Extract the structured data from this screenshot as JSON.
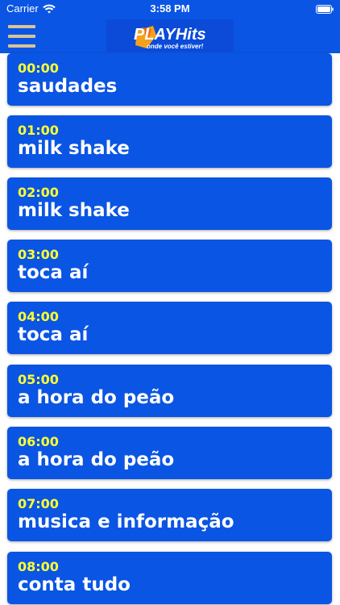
{
  "status_bar": {
    "carrier": "Carrier",
    "time": "3:58 PM",
    "wifi_icon": "wifi-icon",
    "battery_icon": "battery-icon"
  },
  "nav_bar": {
    "menu_icon": "hamburger-menu-icon",
    "logo": {
      "brand": "PLAYHits",
      "tagline": "onde você estiver!"
    }
  },
  "schedule": [
    {
      "time": "00:00",
      "title": "saudades"
    },
    {
      "time": "01:00",
      "title": "milk shake"
    },
    {
      "time": "02:00",
      "title": "milk shake"
    },
    {
      "time": "03:00",
      "title": "toca aí"
    },
    {
      "time": "04:00",
      "title": "toca aí"
    },
    {
      "time": "05:00",
      "title": "a hora do peão"
    },
    {
      "time": "06:00",
      "title": "a hora do peão"
    },
    {
      "time": "07:00",
      "title": "musica e informação"
    },
    {
      "time": "08:00",
      "title": "conta tudo"
    }
  ],
  "colors": {
    "primary": "#0a55e3",
    "time_text": "#ffff33",
    "title_text": "#ffffff",
    "menu_icon": "#d9c394",
    "logo_orange": "#f4a21b"
  }
}
